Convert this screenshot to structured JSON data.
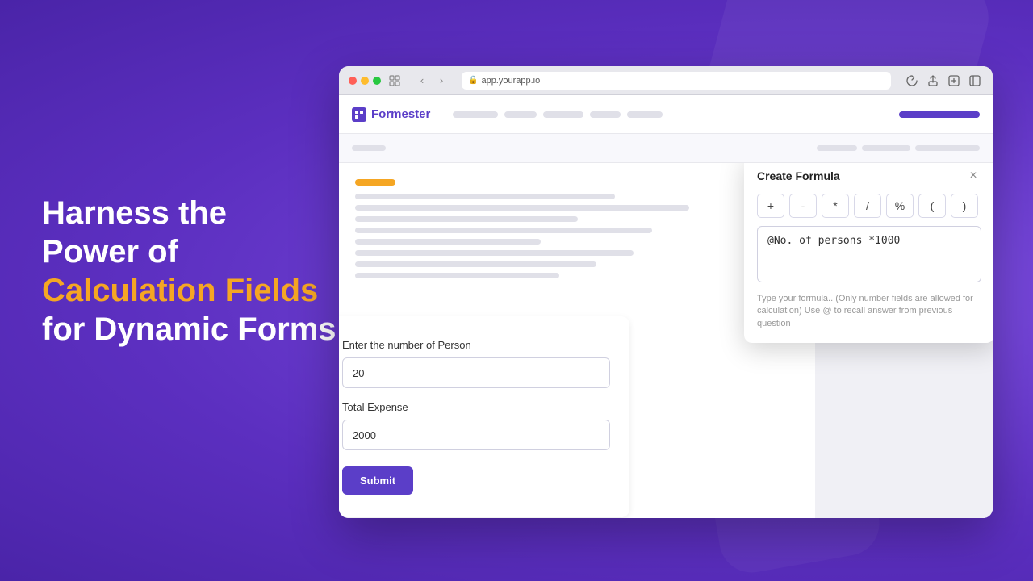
{
  "background": {
    "color": "#6c3fd6"
  },
  "hero": {
    "line1": "Harness the",
    "line2": "Power of",
    "highlight": "Calculation Fields",
    "line3": "for Dynamic Forms"
  },
  "browser": {
    "url": "app.yourapp.io",
    "dots": [
      "red",
      "yellow",
      "green"
    ]
  },
  "appHeader": {
    "logo": "Formester",
    "navBars": [
      60,
      40,
      50,
      40,
      45
    ],
    "rightBarWidth": 100
  },
  "formCard": {
    "field1Label": "Enter the number of Person",
    "field1Value": "20",
    "field2Label": "Total Expense",
    "field2Value": "2000",
    "submitLabel": "Submit"
  },
  "formulaModal": {
    "title": "Create Formula",
    "closeIcon": "×",
    "operators": [
      "+",
      "-",
      "*",
      "/",
      "%",
      "(",
      ")"
    ],
    "formulaValue": "@No. of persons *1000",
    "hintText": "Type your formula.. (Only number fields are allowed for calculation) Use @ to recall answer from previous question"
  }
}
